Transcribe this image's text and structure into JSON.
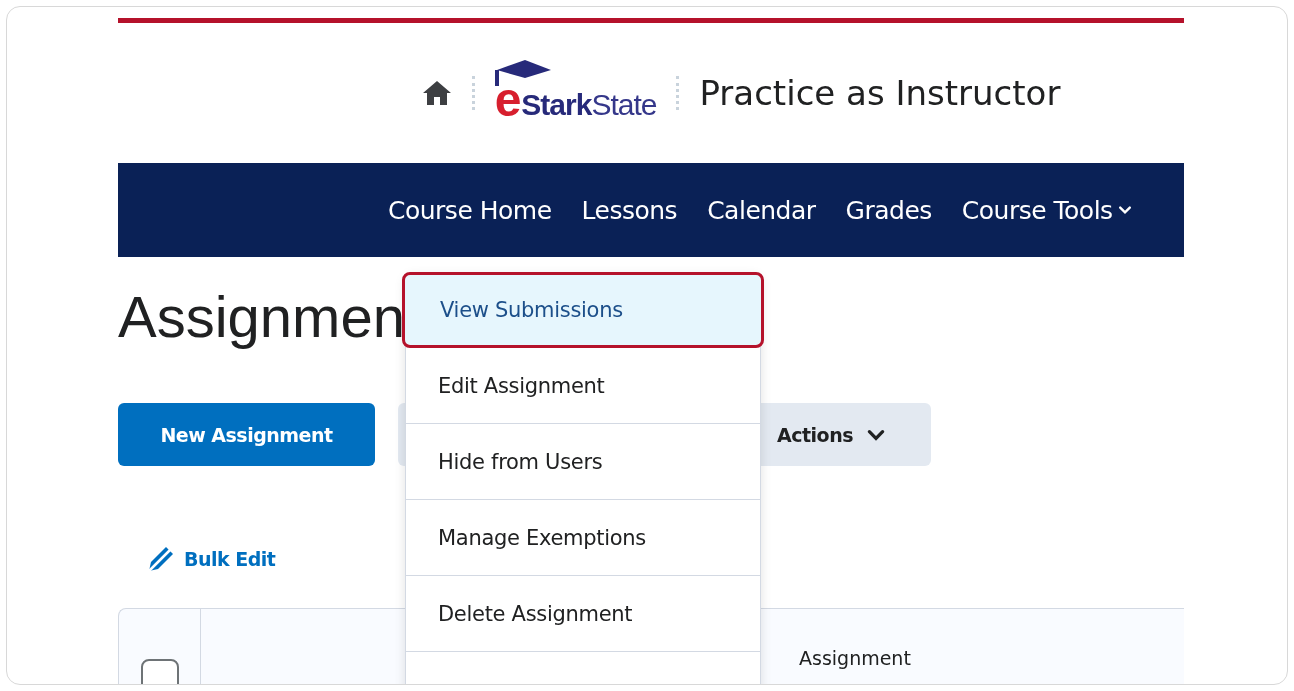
{
  "header": {
    "logo": {
      "letter": "e",
      "bold": "Stark",
      "rest": "State"
    },
    "course_title": "Practice as Instructor"
  },
  "nav": {
    "items": [
      {
        "label": "Course Home",
        "has_menu": false
      },
      {
        "label": "Lessons",
        "has_menu": false
      },
      {
        "label": "Calendar",
        "has_menu": false
      },
      {
        "label": "Grades",
        "has_menu": false
      },
      {
        "label": "Course Tools",
        "has_menu": true
      }
    ]
  },
  "page_title": "Assignmen",
  "toolbar": {
    "primary": "New Assignment",
    "actions": "Actions"
  },
  "bulk_edit": "Bulk Edit",
  "table": {
    "columns": [
      {
        "label": "Assignment"
      }
    ],
    "select_all_checked": false
  },
  "menu": {
    "items": [
      {
        "label": "View Submissions",
        "selected": true
      },
      {
        "label": "Edit Assignment",
        "selected": false
      },
      {
        "label": "Hide from Users",
        "selected": false
      },
      {
        "label": "Manage Exemptions",
        "selected": false
      },
      {
        "label": "Delete Assignment",
        "selected": false
      }
    ]
  }
}
